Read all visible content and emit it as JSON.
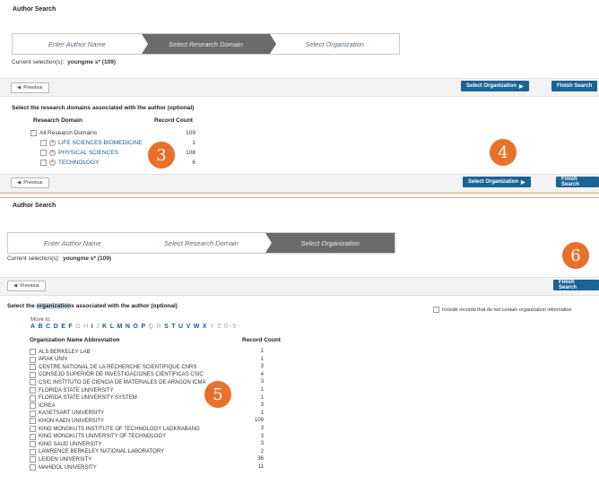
{
  "top": {
    "title": "Author Search",
    "steps": [
      "Enter Author Name",
      "Select Research Domain",
      "Select Organization"
    ],
    "current_selection_label": "Current selection(s):",
    "current_selection_value": "youngme s* (109)",
    "previous_label": "Previous",
    "select_org_label": "Select Organization",
    "finish_label": "Finish Search",
    "instruction": "Select the research domains associated with the author (optional)",
    "col_domain": "Research Domain",
    "col_count": "Record Count",
    "domains": [
      {
        "name": "All Research Domains",
        "count": "109"
      },
      {
        "name": "LIFE SCIENCES BIOMEDICINE",
        "count": "1"
      },
      {
        "name": "PHYSICAL SCIENCES",
        "count": "108"
      },
      {
        "name": "TECHNOLOGY",
        "count": "6"
      }
    ],
    "badge3": "3",
    "badge4": "4"
  },
  "bottom": {
    "title": "Author Search",
    "steps": [
      "Enter Author Name",
      "Select Research Domain",
      "Select Organization"
    ],
    "current_selection_label": "Current selection(s):",
    "current_selection_value": "youngme s* (109)",
    "previous_label": "Previous",
    "finish_label": "Finish Search",
    "instruction_pre": "Select the ",
    "instruction_hl": "organization",
    "instruction_post": "s associated with the author (optional)",
    "include_label": "Include records that do not contain organization information",
    "move_to": "Move to:",
    "col_org": "Organization Name Abbreviation",
    "col_count": "Record Count",
    "alphabet": [
      "A",
      "B",
      "C",
      "D",
      "E",
      "F",
      "G",
      "H",
      "I",
      "J",
      "K",
      "L",
      "M",
      "N",
      "O",
      "P",
      "Q",
      "R",
      "S",
      "T",
      "U",
      "V",
      "W",
      "X",
      "Y",
      "Z",
      "0-9"
    ],
    "orgs": [
      {
        "name": "ALS BERKELEY LAB",
        "count": "1"
      },
      {
        "name": "ARAK UNIV",
        "count": "1"
      },
      {
        "name": "CENTRE NATIONAL DE LA RECHERCHE SCIENTIFIQUE CNRS",
        "count": "3"
      },
      {
        "name": "CONSEJO SUPERIOR DE INVESTIGACIONES CIENTIFICAS CSIC",
        "count": "4"
      },
      {
        "name": "CSIC INSTITUTO DE CIENCIA DE MATERIALES DE ARAGON ICMA",
        "count": "3"
      },
      {
        "name": "FLORIDA STATE UNIVERSITY",
        "count": "1"
      },
      {
        "name": "FLORIDA STATE UNIVERSITY SYSTEM",
        "count": "1"
      },
      {
        "name": "ICREA",
        "count": "3"
      },
      {
        "name": "KASETSART UNIVERSITY",
        "count": "1"
      },
      {
        "name": "KHON KAEN UNIVERSITY",
        "count": "109"
      },
      {
        "name": "KING MONGKUTS INSTITUTE OF TECHNOLOGY LADKRABANG",
        "count": "3"
      },
      {
        "name": "KING MONGKUTS UNIVERSITY OF TECHNOLOGY",
        "count": "3"
      },
      {
        "name": "KING SAUD UNIVERSITY",
        "count": "3"
      },
      {
        "name": "LAWRENCE BERKELEY NATIONAL LABORATORY",
        "count": "2"
      },
      {
        "name": "LEIDEN UNIVERSITY",
        "count": "36"
      },
      {
        "name": "MAHIDOL UNIVERSITY",
        "count": "11"
      }
    ],
    "badge5": "5",
    "badge6": "6"
  }
}
